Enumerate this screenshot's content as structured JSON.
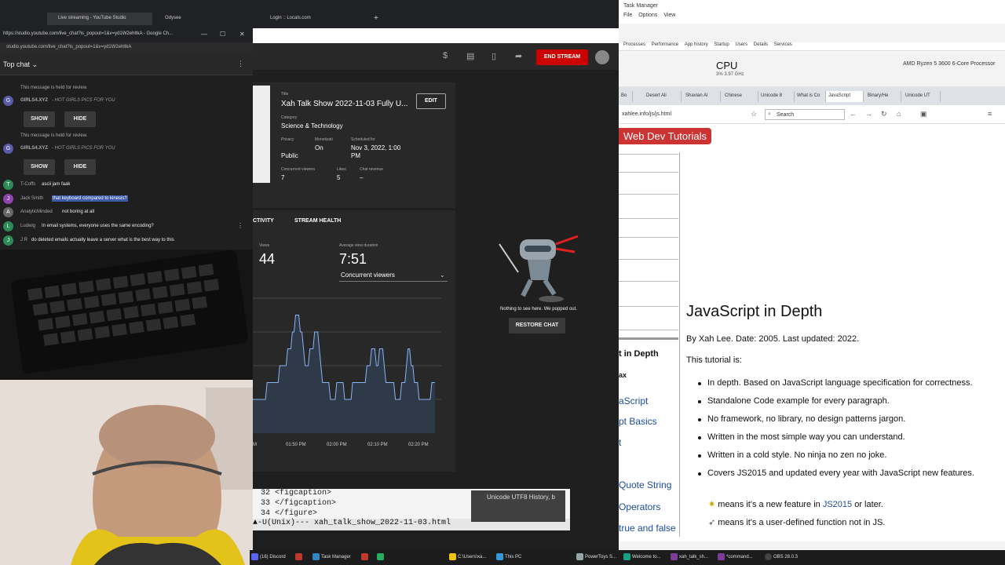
{
  "task_manager": {
    "title": "Task Manager",
    "menu": [
      "File",
      "Options",
      "View"
    ],
    "tabs": [
      "Processes",
      "Performance",
      "App history",
      "Startup",
      "Users",
      "Details",
      "Services"
    ],
    "cpu_label": "CPU",
    "cpu_sub": "3% 3.97 GHz",
    "processor": "AMD Ryzen 5 3600 6-Core Processor"
  },
  "browser_right": {
    "tabs": [
      "Bo",
      "Desert Ali",
      "Shavian Al",
      "Chinese",
      "Unicode 8",
      "What is Co",
      "JavaScript",
      "Binary/He",
      "Unicode UT"
    ],
    "url": "xahlee.info/js/js.html",
    "search_placeholder": "Search"
  },
  "page": {
    "banner": "Web Dev Tutorials",
    "title": "JavaScript in Depth",
    "byline": "By Xah Lee. Date: 2005. Last updated: 2022.",
    "intro": "This tutorial is:",
    "bullets": [
      "In depth. Based on JavaScript language specification for correctness.",
      "Standalone Code example for every paragraph.",
      "No framework, no library, no design patterns jargon.",
      "Written in the most simple way you can understand.",
      "Written in a cold style. No ninja no zen no joke.",
      "Covers JS2015 and updated every year with JavaScript new features."
    ],
    "note1_pre": "means it's a new feature in ",
    "note1_link": "JS2015",
    "note1_post": " or later.",
    "note2": "means it's a user-defined function not in JS.",
    "nav": {
      "bold1": "t in Depth",
      "bold2": "ax",
      "l1": "aScript",
      "l2": "pt Basics",
      "l3": "t",
      "l4": "Quote String",
      "l5": "Operators",
      "l6": "true and false"
    }
  },
  "chat_window": {
    "titlebar": "https://studio.youtube.com/live_chat?is_popout=1&v=yd1W2ehltkA - Google Ch...",
    "url": "studio.youtube.com/live_chat?is_popout=1&v=yd1W2ehltkA",
    "title": "Top chat",
    "held1": "This message is held for review.",
    "held2": "This message is held for review.",
    "spam_author": "GIRLS4.XYZ",
    "spam_msg": "- HOT GIRLS PICS FOR YOU",
    "show": "SHOW",
    "hide": "HIDE",
    "messages": [
      {
        "author": "T-Coffs",
        "text": "ascii jam faak"
      },
      {
        "author": "Jack Smith",
        "text": "that keyboard compared to kinesis?"
      },
      {
        "author": "AnalyticMinded",
        "text": "not boring at all"
      },
      {
        "author": "Ludwig",
        "text": "In email systems, everyone uses the same encoding?"
      },
      {
        "author": "J R",
        "text": "do deleted emails actually leave a server what is the best way to this"
      }
    ]
  },
  "top_tabs": [
    "Live streaming - YouTube Studio",
    "Odysee",
    "Login :: Locals.com"
  ],
  "studio": {
    "end_stream": "END STREAM",
    "title_label": "Title",
    "title": "Xah Talk Show 2022-11-03 Fully U...",
    "edit": "EDIT",
    "category_label": "Category",
    "category": "Science & Technology",
    "privacy_label": "Privacy",
    "privacy": "Public",
    "monet_label": "Monetizati",
    "monet": "On",
    "sched_label": "Scheduled for",
    "sched1": "Nov 3, 2022, 1:00",
    "sched2": "PM",
    "cv_label": "Concurrent viewers",
    "cv": "7",
    "likes_label": "Likes",
    "likes": "5",
    "rev_label": "Chat revenue",
    "rev": "–",
    "tab_activity": "CTIVITY",
    "tab_health": "STREAM HEALTH",
    "views_label": "Views",
    "views": "44",
    "avg_label": "Average view duration",
    "avg": "7:51",
    "metric": "Concurrent viewers",
    "popped": "Nothing to see here. We popped out.",
    "restore": "RESTORE CHAT"
  },
  "chart_data": {
    "type": "area",
    "x": [
      "M",
      "01:50 PM",
      "02:00 PM",
      "02:10 PM",
      "02:20 PM"
    ],
    "xlabel": "",
    "ylabel": "",
    "values": [
      2,
      2,
      2,
      2,
      2,
      2,
      2,
      2,
      2,
      3,
      3,
      3,
      3,
      3,
      3,
      3,
      3,
      4,
      4,
      4,
      4,
      4,
      5,
      5,
      5,
      6,
      6,
      7,
      7,
      7,
      6,
      6,
      5,
      4,
      4,
      4,
      5,
      5,
      5,
      6,
      6,
      6,
      5,
      4,
      3,
      3,
      3,
      3,
      3,
      2,
      2,
      2,
      2,
      3,
      3,
      3,
      3,
      3,
      2,
      2,
      2,
      2,
      2,
      3,
      3,
      3,
      3,
      3,
      3,
      3,
      3,
      3,
      4,
      4,
      4,
      5,
      5,
      5,
      4,
      4,
      5,
      5,
      5,
      4,
      3,
      3,
      3,
      3,
      3,
      3,
      2,
      2,
      2,
      2,
      3,
      3,
      3,
      4,
      5,
      5,
      4,
      4,
      3,
      3,
      3,
      2,
      2,
      2,
      2,
      2,
      2,
      2,
      2,
      3,
      3,
      3
    ],
    "ylim": [
      0,
      8
    ]
  },
  "terminal": {
    "lines": [
      "32  <figcaption>",
      "33  </figcaption>",
      "34  </figure>"
    ],
    "status": "-U(Unix)---  xah_talk_show_2022-11-03.html",
    "tooltip": "Unicode UTF8 History, b"
  },
  "taskbar": [
    "(16) Discord",
    "Task Manager",
    "C:\\Users\\xa...",
    "This PC",
    "PowerToys S...",
    "Welcome to...",
    "xah_talk_sh...",
    "*command...",
    "OBS 28.0.3"
  ],
  "colors": {
    "yt_red": "#cc0000",
    "highlight": "#3d5aa8",
    "link": "#1a4b9c"
  }
}
